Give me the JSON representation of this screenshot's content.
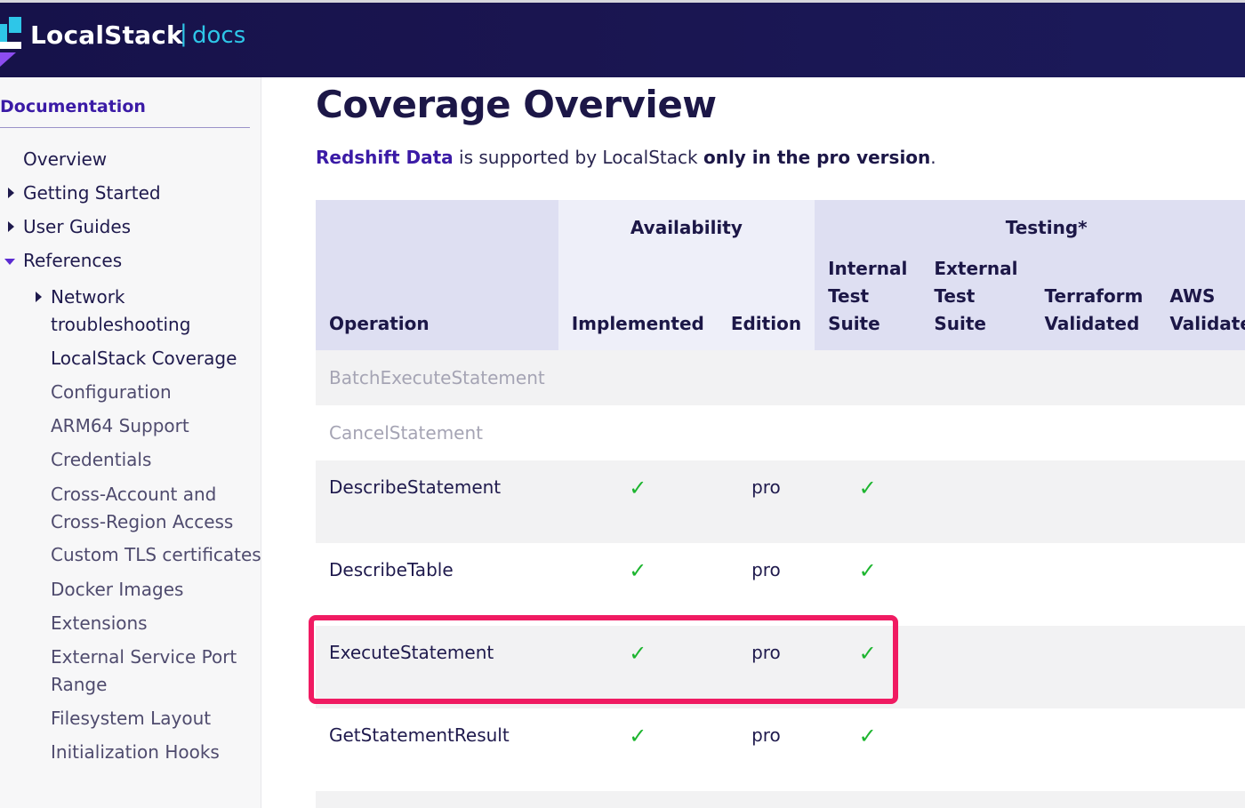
{
  "header": {
    "brand": "LocalStack",
    "separator": "|",
    "section": "docs",
    "colors": {
      "background": "#16124a",
      "accent": "#2ec6e8",
      "logo": "#2ec6e8"
    }
  },
  "sidebar": {
    "title": "Documentation",
    "items": [
      {
        "label": "Overview"
      },
      {
        "label": "Getting Started",
        "caret": "right"
      },
      {
        "label": "User Guides",
        "caret": "right"
      },
      {
        "label": "References",
        "caret": "down"
      },
      {
        "label": "Network",
        "label2": "troubleshooting",
        "caret": "right"
      },
      {
        "label": "LocalStack Coverage"
      },
      {
        "label": "Configuration"
      },
      {
        "label": "ARM64 Support"
      },
      {
        "label": "Credentials"
      },
      {
        "label": "Cross-Account and",
        "label2": "Cross-Region Access"
      },
      {
        "label": "Custom TLS certificates"
      },
      {
        "label": "Docker Images"
      },
      {
        "label": "Extensions"
      },
      {
        "label": "External Service Port",
        "label2": "Range"
      },
      {
        "label": "Filesystem Layout"
      },
      {
        "label": "Initialization Hooks"
      }
    ]
  },
  "main": {
    "title": "Coverage Overview",
    "intro": {
      "service": "Redshift Data",
      "middle": " is supported by LocalStack ",
      "emphasis": "only in the pro version",
      "end": "."
    },
    "table": {
      "group_headers": {
        "availability": "Availability",
        "testing": "Testing*"
      },
      "columns": {
        "operation": "Operation",
        "implemented": "Implemented",
        "edition": "Edition",
        "internal_1": "Internal",
        "internal_2": "Test",
        "internal_3": "Suite",
        "external_1": "External",
        "external_2": "Test Suite",
        "terraform_1": "Terraform",
        "terraform_2": "Validated",
        "aws_1": "AWS",
        "aws_2": "Validated"
      },
      "rows": [
        {
          "operation": "BatchExecuteStatement",
          "implemented": "",
          "edition": "",
          "internal": ""
        },
        {
          "operation": "CancelStatement",
          "implemented": "",
          "edition": "",
          "internal": ""
        },
        {
          "operation": "DescribeStatement",
          "implemented": "✓",
          "edition": "pro",
          "internal": "✓"
        },
        {
          "operation": "DescribeTable",
          "implemented": "✓",
          "edition": "pro",
          "internal": "✓"
        },
        {
          "operation": "ExecuteStatement",
          "implemented": "✓",
          "edition": "pro",
          "internal": "✓",
          "highlighted": true
        },
        {
          "operation": "GetStatementResult",
          "implemented": "✓",
          "edition": "pro",
          "internal": "✓"
        }
      ]
    },
    "colors": {
      "check": "#1db52f",
      "highlight": "#f01b62",
      "link": "#3b1ba6"
    }
  }
}
